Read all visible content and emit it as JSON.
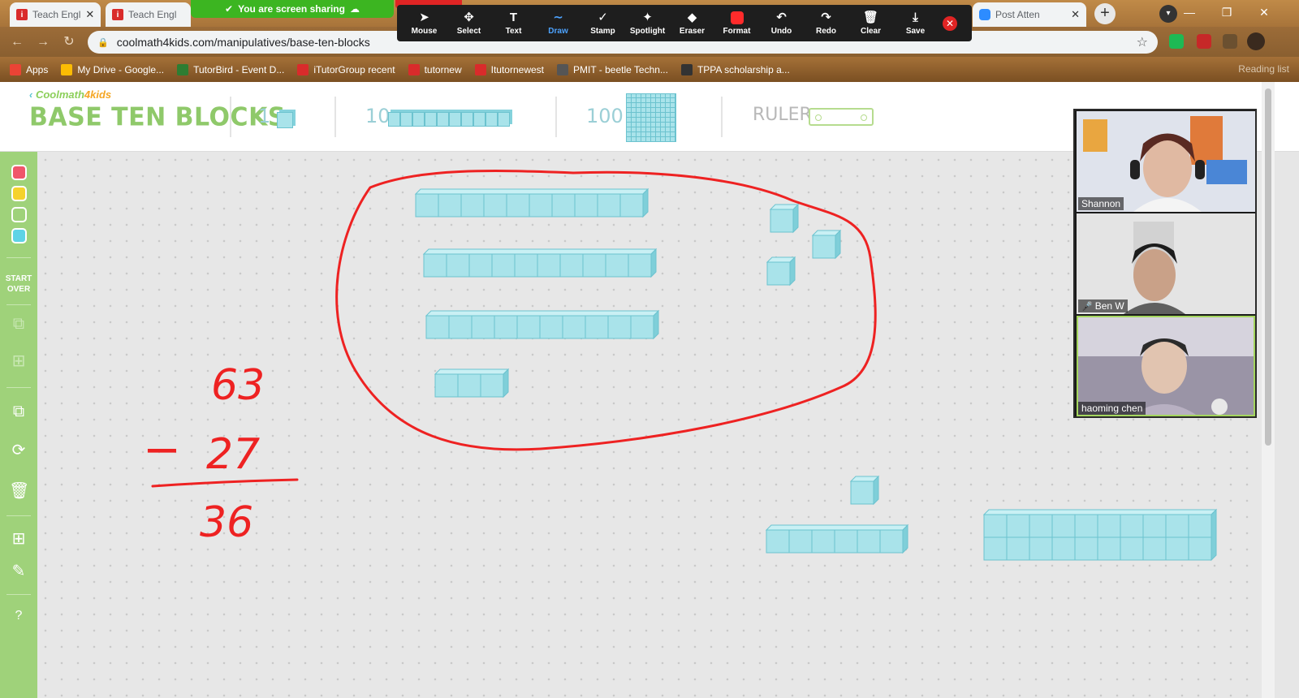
{
  "browser": {
    "tabs": [
      {
        "title": "Teach Engl",
        "favicon": "i"
      },
      {
        "title": "Teach Engl",
        "favicon": "i"
      },
      {
        "title": "Post Atten",
        "favicon": "zoom"
      }
    ],
    "share_banner": "You are screen sharing",
    "url": "coolmath4kids.com/manipulatives/base-ten-blocks",
    "bookmarks": [
      {
        "label": "Apps",
        "color": "#ea4335"
      },
      {
        "label": "My Drive - Google...",
        "color": "#fbbc04"
      },
      {
        "label": "TutorBird - Event D...",
        "color": "#2e7d32"
      },
      {
        "label": "iTutorGroup recent",
        "color": "#d92b2b"
      },
      {
        "label": "tutornew",
        "color": "#d92b2b"
      },
      {
        "label": "Itutornewest",
        "color": "#d92b2b"
      },
      {
        "label": "PMIT - beetle Techn...",
        "color": "#555555"
      },
      {
        "label": "TPPA scholarship a...",
        "color": "#333333"
      }
    ],
    "reading_list": "Reading list"
  },
  "annotate_toolbar": {
    "tools": [
      {
        "label": "Mouse",
        "icon": "➤"
      },
      {
        "label": "Select",
        "icon": "✥"
      },
      {
        "label": "Text",
        "icon": "T"
      },
      {
        "label": "Draw",
        "icon": "∼",
        "active": true
      },
      {
        "label": "Stamp",
        "icon": "✓"
      },
      {
        "label": "Spotlight",
        "icon": "✦"
      },
      {
        "label": "Eraser",
        "icon": "◆"
      },
      {
        "label": "Format",
        "icon": "swatch"
      },
      {
        "label": "Undo",
        "icon": "↶"
      },
      {
        "label": "Redo",
        "icon": "↷"
      },
      {
        "label": "Clear",
        "icon": "🗑"
      },
      {
        "label": "Save",
        "icon": "⤓"
      }
    ],
    "format_color": "#ff2b2b"
  },
  "app": {
    "brand": "Coolmath",
    "brand_suffix": "4kids",
    "title": "BASE TEN BLOCKS",
    "block_labels": {
      "ones": "1",
      "tens": "10",
      "hundreds": "100"
    },
    "ruler_label": "RULER",
    "sidebar": {
      "colors": [
        "#f0566a",
        "#f5d22c",
        "#9fd27a",
        "#5ed3e6"
      ],
      "start_over": "START OVER",
      "icons": [
        "group-icon",
        "ungroup-icon",
        "duplicate-icon",
        "rotate-icon",
        "trash-icon",
        "calculator-icon",
        "pencil-icon",
        "help-icon"
      ]
    }
  },
  "canvas": {
    "handwriting": {
      "minuend": "63",
      "operator": "−",
      "subtrahend": "27",
      "result": "36"
    },
    "ink_color": "#ee2222"
  },
  "participants": [
    {
      "name": "Shannon",
      "muted": false
    },
    {
      "name": "Ben W",
      "muted": true
    },
    {
      "name": "haoming   chen",
      "muted": false,
      "active": true
    }
  ]
}
